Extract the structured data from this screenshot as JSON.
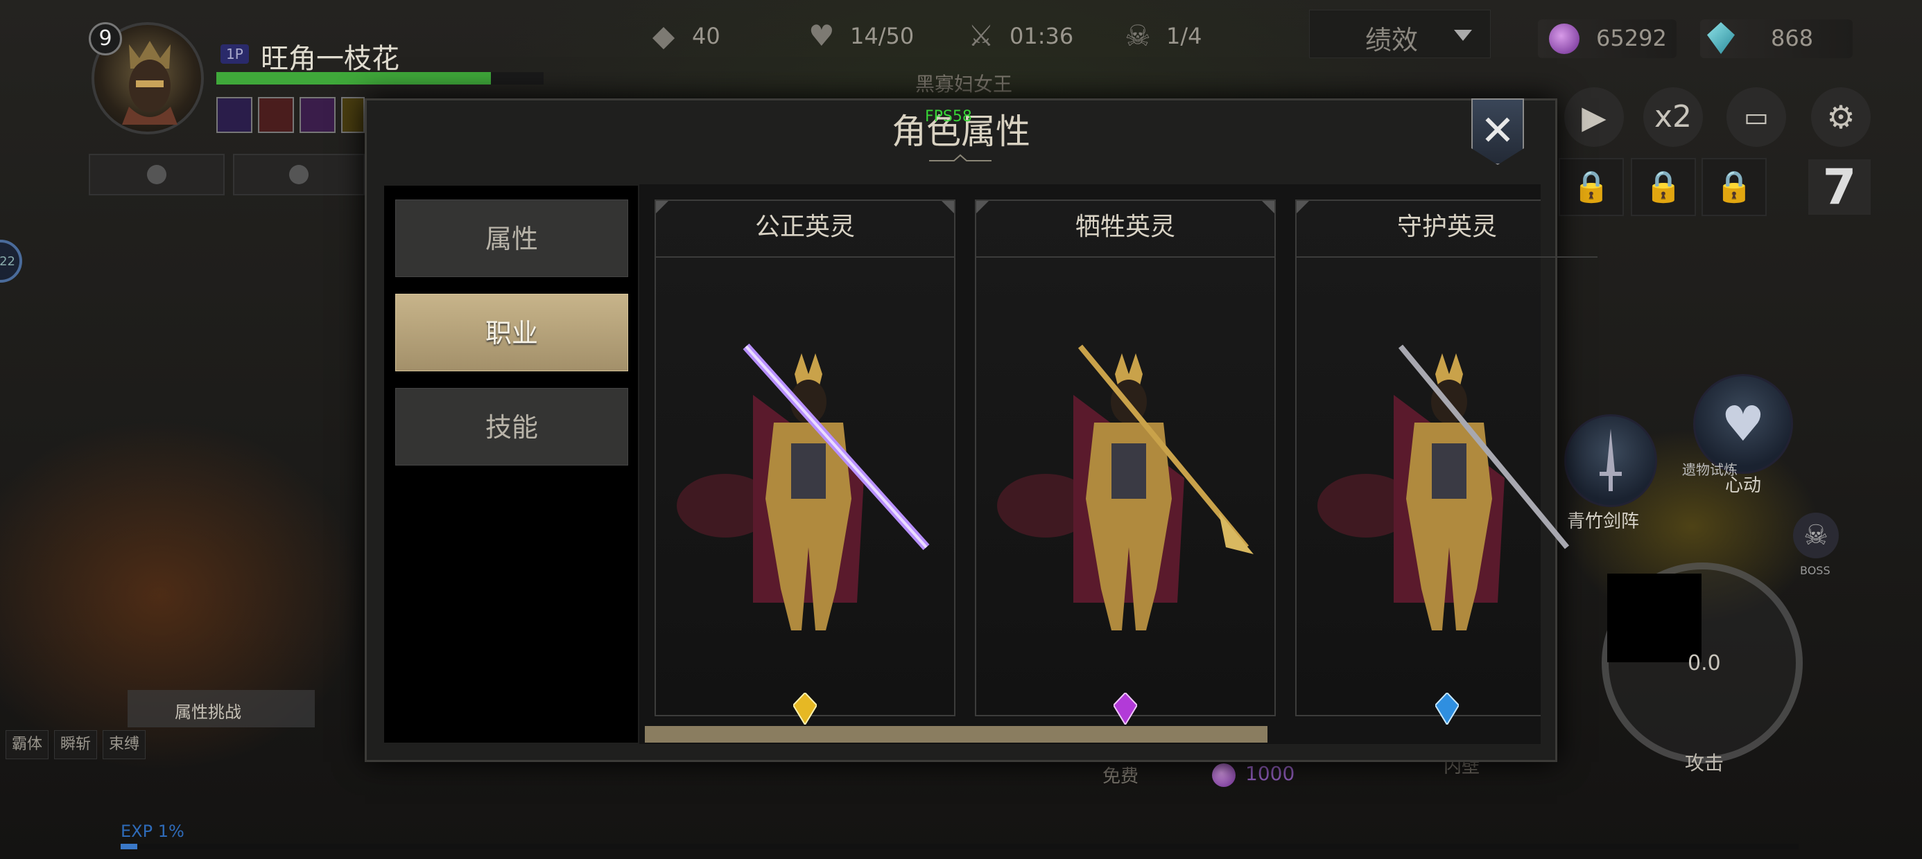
{
  "player": {
    "level": "9",
    "tag": "1P",
    "name": "旺角一枝花",
    "hp_fraction": 0.84
  },
  "top_stats": {
    "resource1": "40",
    "hp": "14/50",
    "timer": "01:36",
    "kills": "1/4"
  },
  "performance_select": "绩效",
  "currency": {
    "gems_purple": "65292",
    "gems_blue": "868"
  },
  "boss_name": "黑寡妇女王",
  "speed": "x2",
  "slot_number": "7",
  "side_badge": "22",
  "modal": {
    "title": "角色属性",
    "fps": "FPS58",
    "tabs": [
      {
        "label": "属性",
        "active": false
      },
      {
        "label": "职业",
        "active": true
      },
      {
        "label": "技能",
        "active": false
      }
    ],
    "classes": [
      {
        "name": "公正英灵",
        "gem_color": "#e6b824"
      },
      {
        "name": "牺牲英灵",
        "gem_color": "#b23ad8"
      },
      {
        "name": "守护英灵",
        "gem_color": "#2f8fe0"
      }
    ],
    "scroll_fraction": 0.69
  },
  "bottom": {
    "attr_challenge": "属性挑战",
    "tags": [
      "霸体",
      "瞬斩",
      "束缚"
    ],
    "exp": "EXP 1%",
    "free": "免费",
    "cost": "1000",
    "partial_label": "内壁"
  },
  "right_skills": {
    "skill1": "青竹剑阵",
    "skill2_top": "遗物试炼",
    "skill2": "心动",
    "boss": "BOSS",
    "cooldown": "0.0",
    "attack": "攻击"
  },
  "colors": {
    "accent_gold": "#c7b48a",
    "hp_green": "#3fa83a",
    "fps_green": "#37d436",
    "exp_blue": "#2e6bb8"
  }
}
